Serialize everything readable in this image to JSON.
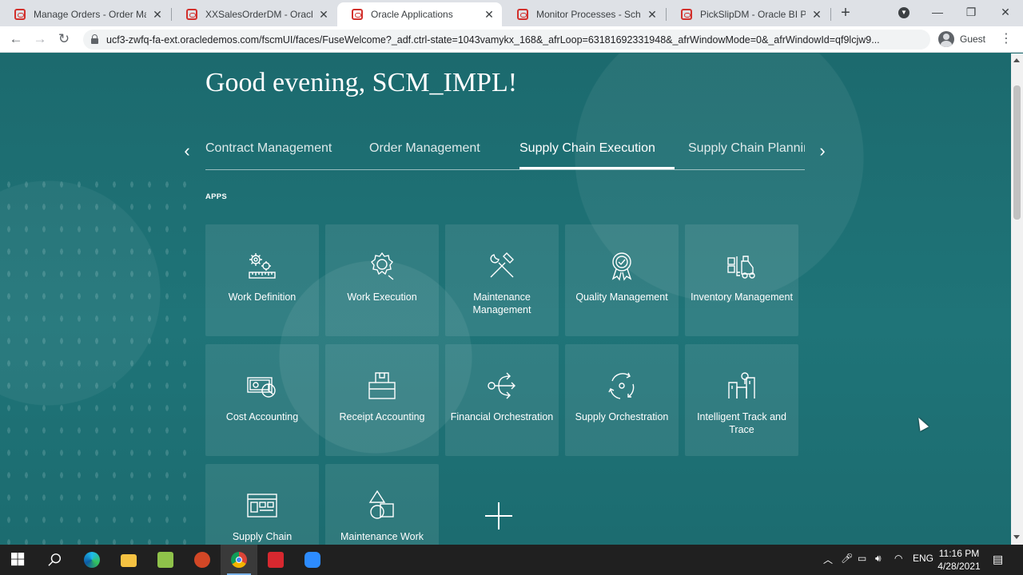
{
  "browser": {
    "tabs": [
      {
        "title": "Manage Orders - Order Mana",
        "active": false
      },
      {
        "title": "XXSalesOrderDM - Oracle BI",
        "active": false
      },
      {
        "title": "Oracle Applications",
        "active": true
      },
      {
        "title": "Monitor Processes - Schedu",
        "active": false
      },
      {
        "title": "PickSlipDM - Oracle BI Publis",
        "active": false
      }
    ],
    "tab_close": "✕",
    "new_tab": "+",
    "url": "ucf3-zwfq-fa-ext.oracledemos.com/fscmUI/faces/FuseWelcome?_adf.ctrl-state=1043vamykx_168&_afrLoop=63181692331948&_afrWindowMode=0&_afrWindowId=qf9lcjw9...",
    "profile_label": "Guest"
  },
  "page": {
    "greeting": "Good evening, SCM_IMPL!",
    "categories": [
      {
        "label": "Contract Management",
        "active": false
      },
      {
        "label": "Order Management",
        "active": false
      },
      {
        "label": "Supply Chain Execution",
        "active": true
      },
      {
        "label": "Supply Chain Plannin",
        "active": false
      }
    ],
    "apps_label": "APPS",
    "apps": [
      {
        "label": "Work Definition",
        "icon": "gears-ruler-icon"
      },
      {
        "label": "Work Execution",
        "icon": "gear-icon"
      },
      {
        "label": "Maintenance Management",
        "icon": "wrench-hammer-icon"
      },
      {
        "label": "Quality Management",
        "icon": "award-badge-icon"
      },
      {
        "label": "Inventory Management",
        "icon": "forklift-icon"
      },
      {
        "label": "Cost Accounting",
        "icon": "money-pie-icon"
      },
      {
        "label": "Receipt Accounting",
        "icon": "package-icon"
      },
      {
        "label": "Financial Orchestration",
        "icon": "flow-arrows-icon"
      },
      {
        "label": "Supply Orchestration",
        "icon": "cycle-arrows-icon"
      },
      {
        "label": "Intelligent Track and Trace",
        "icon": "track-trace-icon"
      },
      {
        "label": "Supply Chain",
        "icon": "dashboard-panel-icon"
      },
      {
        "label": "Maintenance Work",
        "icon": "shapes-icon"
      }
    ]
  },
  "taskbar": {
    "apps": [
      "windows-start-icon",
      "search-icon",
      "edge-icon",
      "file-explorer-icon",
      "notepad-icon",
      "powerpoint-icon",
      "chrome-icon",
      "acrobat-icon",
      "zoom-icon"
    ],
    "language": "ENG",
    "time": "11:16 PM",
    "date": "4/28/2021"
  },
  "colors": {
    "page_bg": "#1e6f72",
    "tab_favicon": "#d2302c",
    "taskbar_bg": "#202020"
  }
}
